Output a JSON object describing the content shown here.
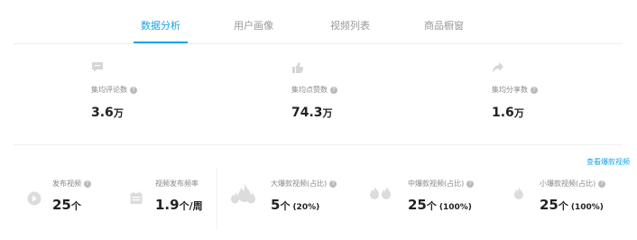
{
  "tabs": [
    {
      "label": "数据分析",
      "active": true
    },
    {
      "label": "用户画像",
      "active": false
    },
    {
      "label": "视频列表",
      "active": false
    },
    {
      "label": "商品橱窗",
      "active": false
    }
  ],
  "metrics": [
    {
      "icon": "comment-icon",
      "label": "集均评论数",
      "value": "3.6",
      "unit": "万"
    },
    {
      "icon": "thumbs-up-icon",
      "label": "集均点赞数",
      "value": "74.3",
      "unit": "万"
    },
    {
      "icon": "share-icon",
      "label": "集均分享数",
      "value": "1.6",
      "unit": "万"
    }
  ],
  "view_link": "查看爆款视频",
  "stats": [
    {
      "icon": "play-icon",
      "label": "发布视频",
      "value": "25",
      "unit": "个",
      "pct": ""
    },
    {
      "icon": "calendar-icon",
      "label": "视频发布频率",
      "value": "1.9",
      "unit": "个/周",
      "pct": ""
    },
    {
      "icon": "fire-large-icon",
      "label": "大爆款视频(占比)",
      "value": "5",
      "unit": "个",
      "pct": "(20%)"
    },
    {
      "icon": "fire-medium-icon",
      "label": "中爆款视频(占比)",
      "value": "25",
      "unit": "个",
      "pct": "(100%)"
    },
    {
      "icon": "fire-small-icon",
      "label": "小爆款视频(占比)",
      "value": "25",
      "unit": "个",
      "pct": "(100%)"
    }
  ],
  "help_glyph": "?",
  "colors": {
    "accent": "#1aa3e8",
    "icon_gray": "#d6d6d6"
  }
}
